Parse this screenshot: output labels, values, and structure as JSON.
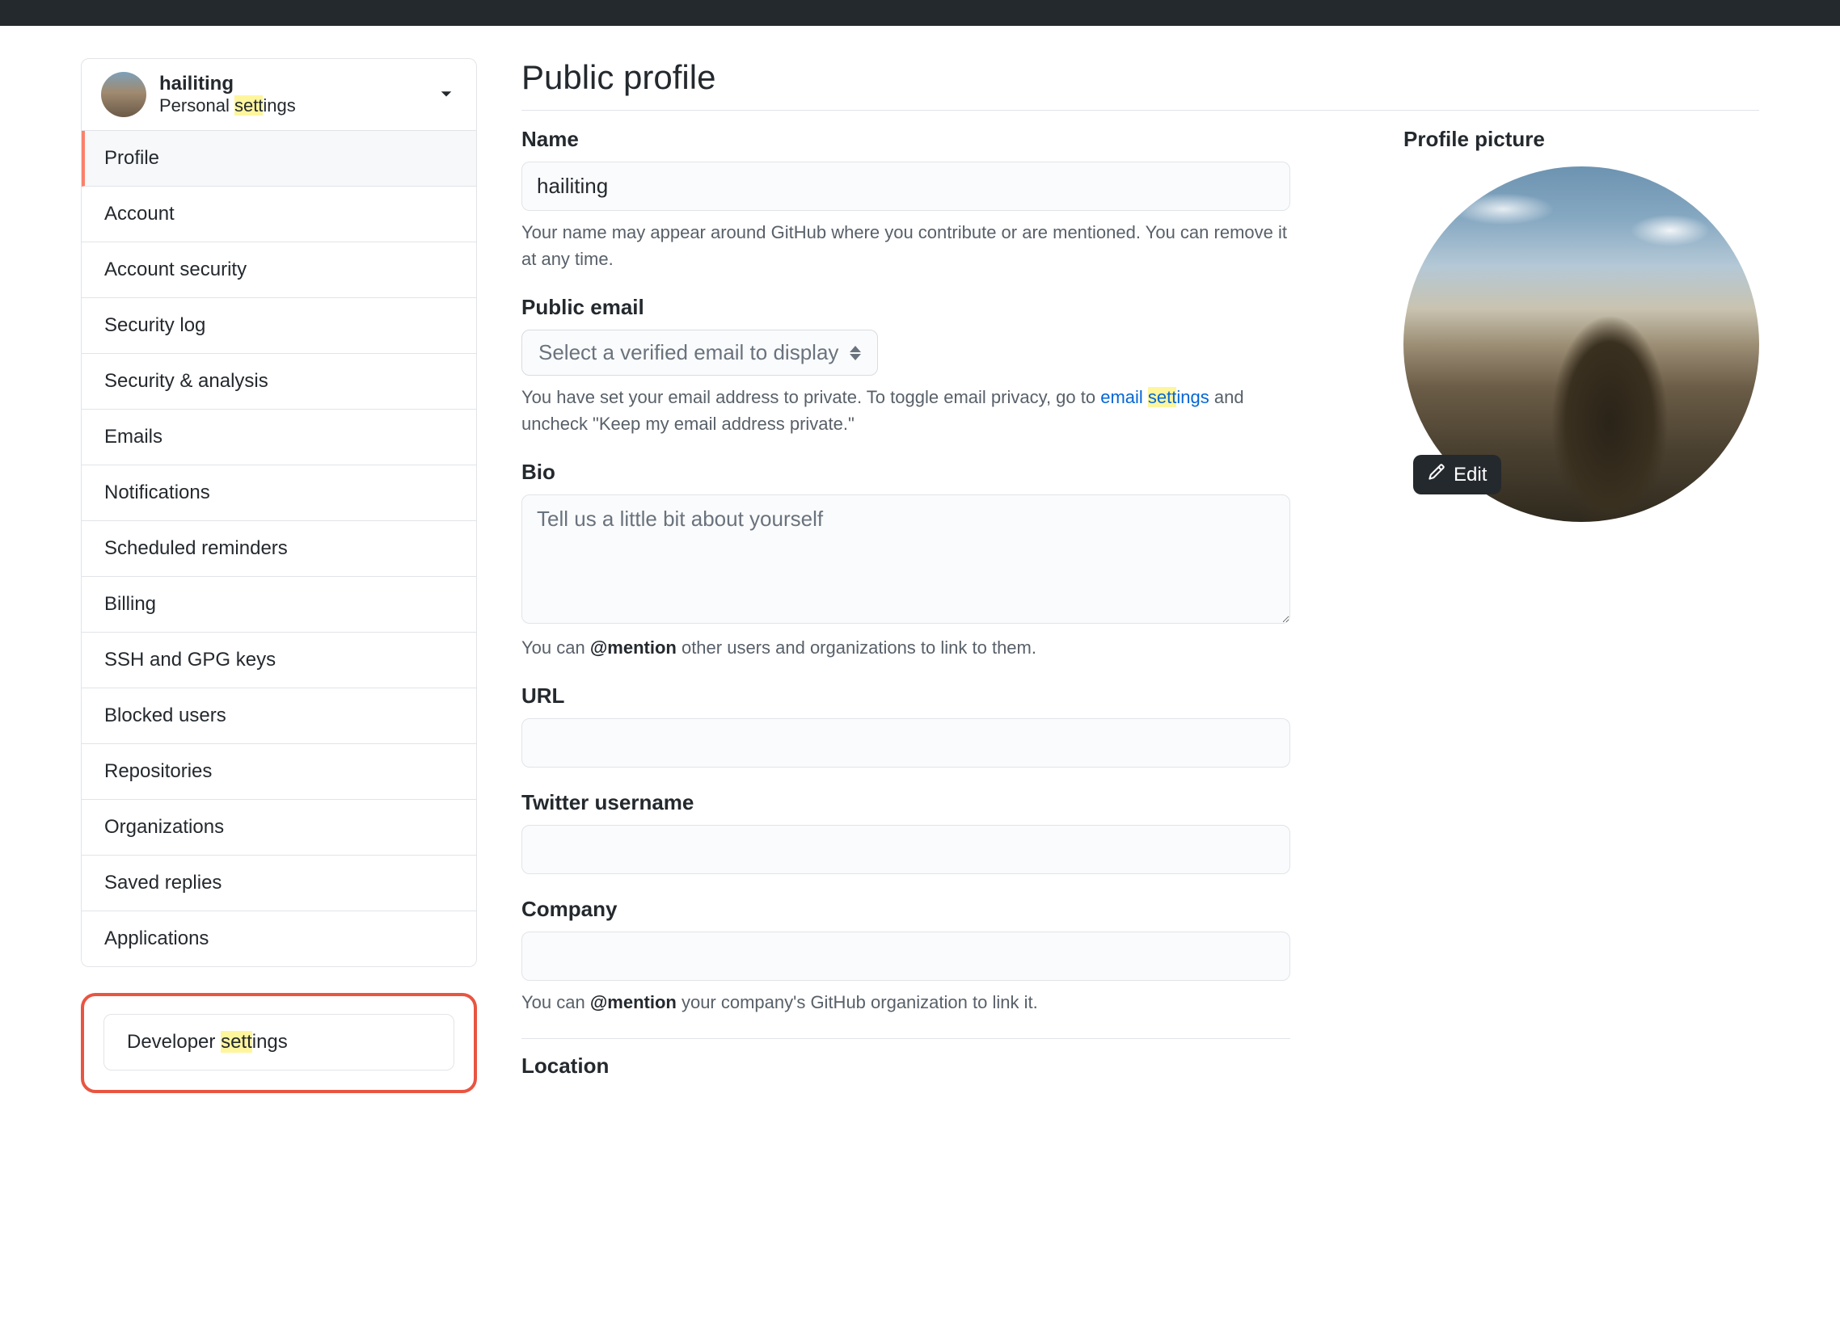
{
  "header": {
    "username": "hailiting",
    "subtitle_pre": "Personal ",
    "subtitle_hl": "sett",
    "subtitle_post": "ings"
  },
  "sidebar": {
    "items": [
      {
        "label": "Profile",
        "active": true,
        "key": "profile"
      },
      {
        "label": "Account",
        "active": false,
        "key": "account"
      },
      {
        "label": "Account security",
        "active": false,
        "key": "account-security"
      },
      {
        "label": "Security log",
        "active": false,
        "key": "security-log"
      },
      {
        "label": "Security & analysis",
        "active": false,
        "key": "security-analysis"
      },
      {
        "label": "Emails",
        "active": false,
        "key": "emails"
      },
      {
        "label": "Notifications",
        "active": false,
        "key": "notifications"
      },
      {
        "label": "Scheduled reminders",
        "active": false,
        "key": "scheduled-reminders"
      },
      {
        "label": "Billing",
        "active": false,
        "key": "billing"
      },
      {
        "label": "SSH and GPG keys",
        "active": false,
        "key": "ssh-gpg"
      },
      {
        "label": "Blocked users",
        "active": false,
        "key": "blocked-users"
      },
      {
        "label": "Repositories",
        "active": false,
        "key": "repositories"
      },
      {
        "label": "Organizations",
        "active": false,
        "key": "organizations"
      },
      {
        "label": "Saved replies",
        "active": false,
        "key": "saved-replies"
      },
      {
        "label": "Applications",
        "active": false,
        "key": "applications"
      }
    ],
    "dev_pre": "Developer ",
    "dev_hl": "sett",
    "dev_post": "ings"
  },
  "page": {
    "title": "Public profile"
  },
  "form": {
    "name_label": "Name",
    "name_value": "hailiting",
    "name_help": "Your name may appear around GitHub where you contribute or are mentioned. You can remove it at any time.",
    "email_label": "Public email",
    "email_select_placeholder": "Select a verified email to display",
    "email_help_pre": "You have set your email address to private. To toggle email privacy, go to ",
    "email_help_link_pre": "email ",
    "email_help_link_hl": "sett",
    "email_help_link_post": "ings",
    "email_help_post": " and uncheck \"Keep my email address private.\"",
    "bio_label": "Bio",
    "bio_placeholder": "Tell us a little bit about yourself",
    "bio_help_pre": "You can ",
    "bio_help_strong": "@mention",
    "bio_help_post": " other users and organizations to link to them.",
    "url_label": "URL",
    "twitter_label": "Twitter username",
    "company_label": "Company",
    "company_help_pre": "You can ",
    "company_help_strong": "@mention",
    "company_help_post": " your company's GitHub organization to link it.",
    "location_label": "Location"
  },
  "picture": {
    "title": "Profile picture",
    "edit_label": "Edit"
  }
}
